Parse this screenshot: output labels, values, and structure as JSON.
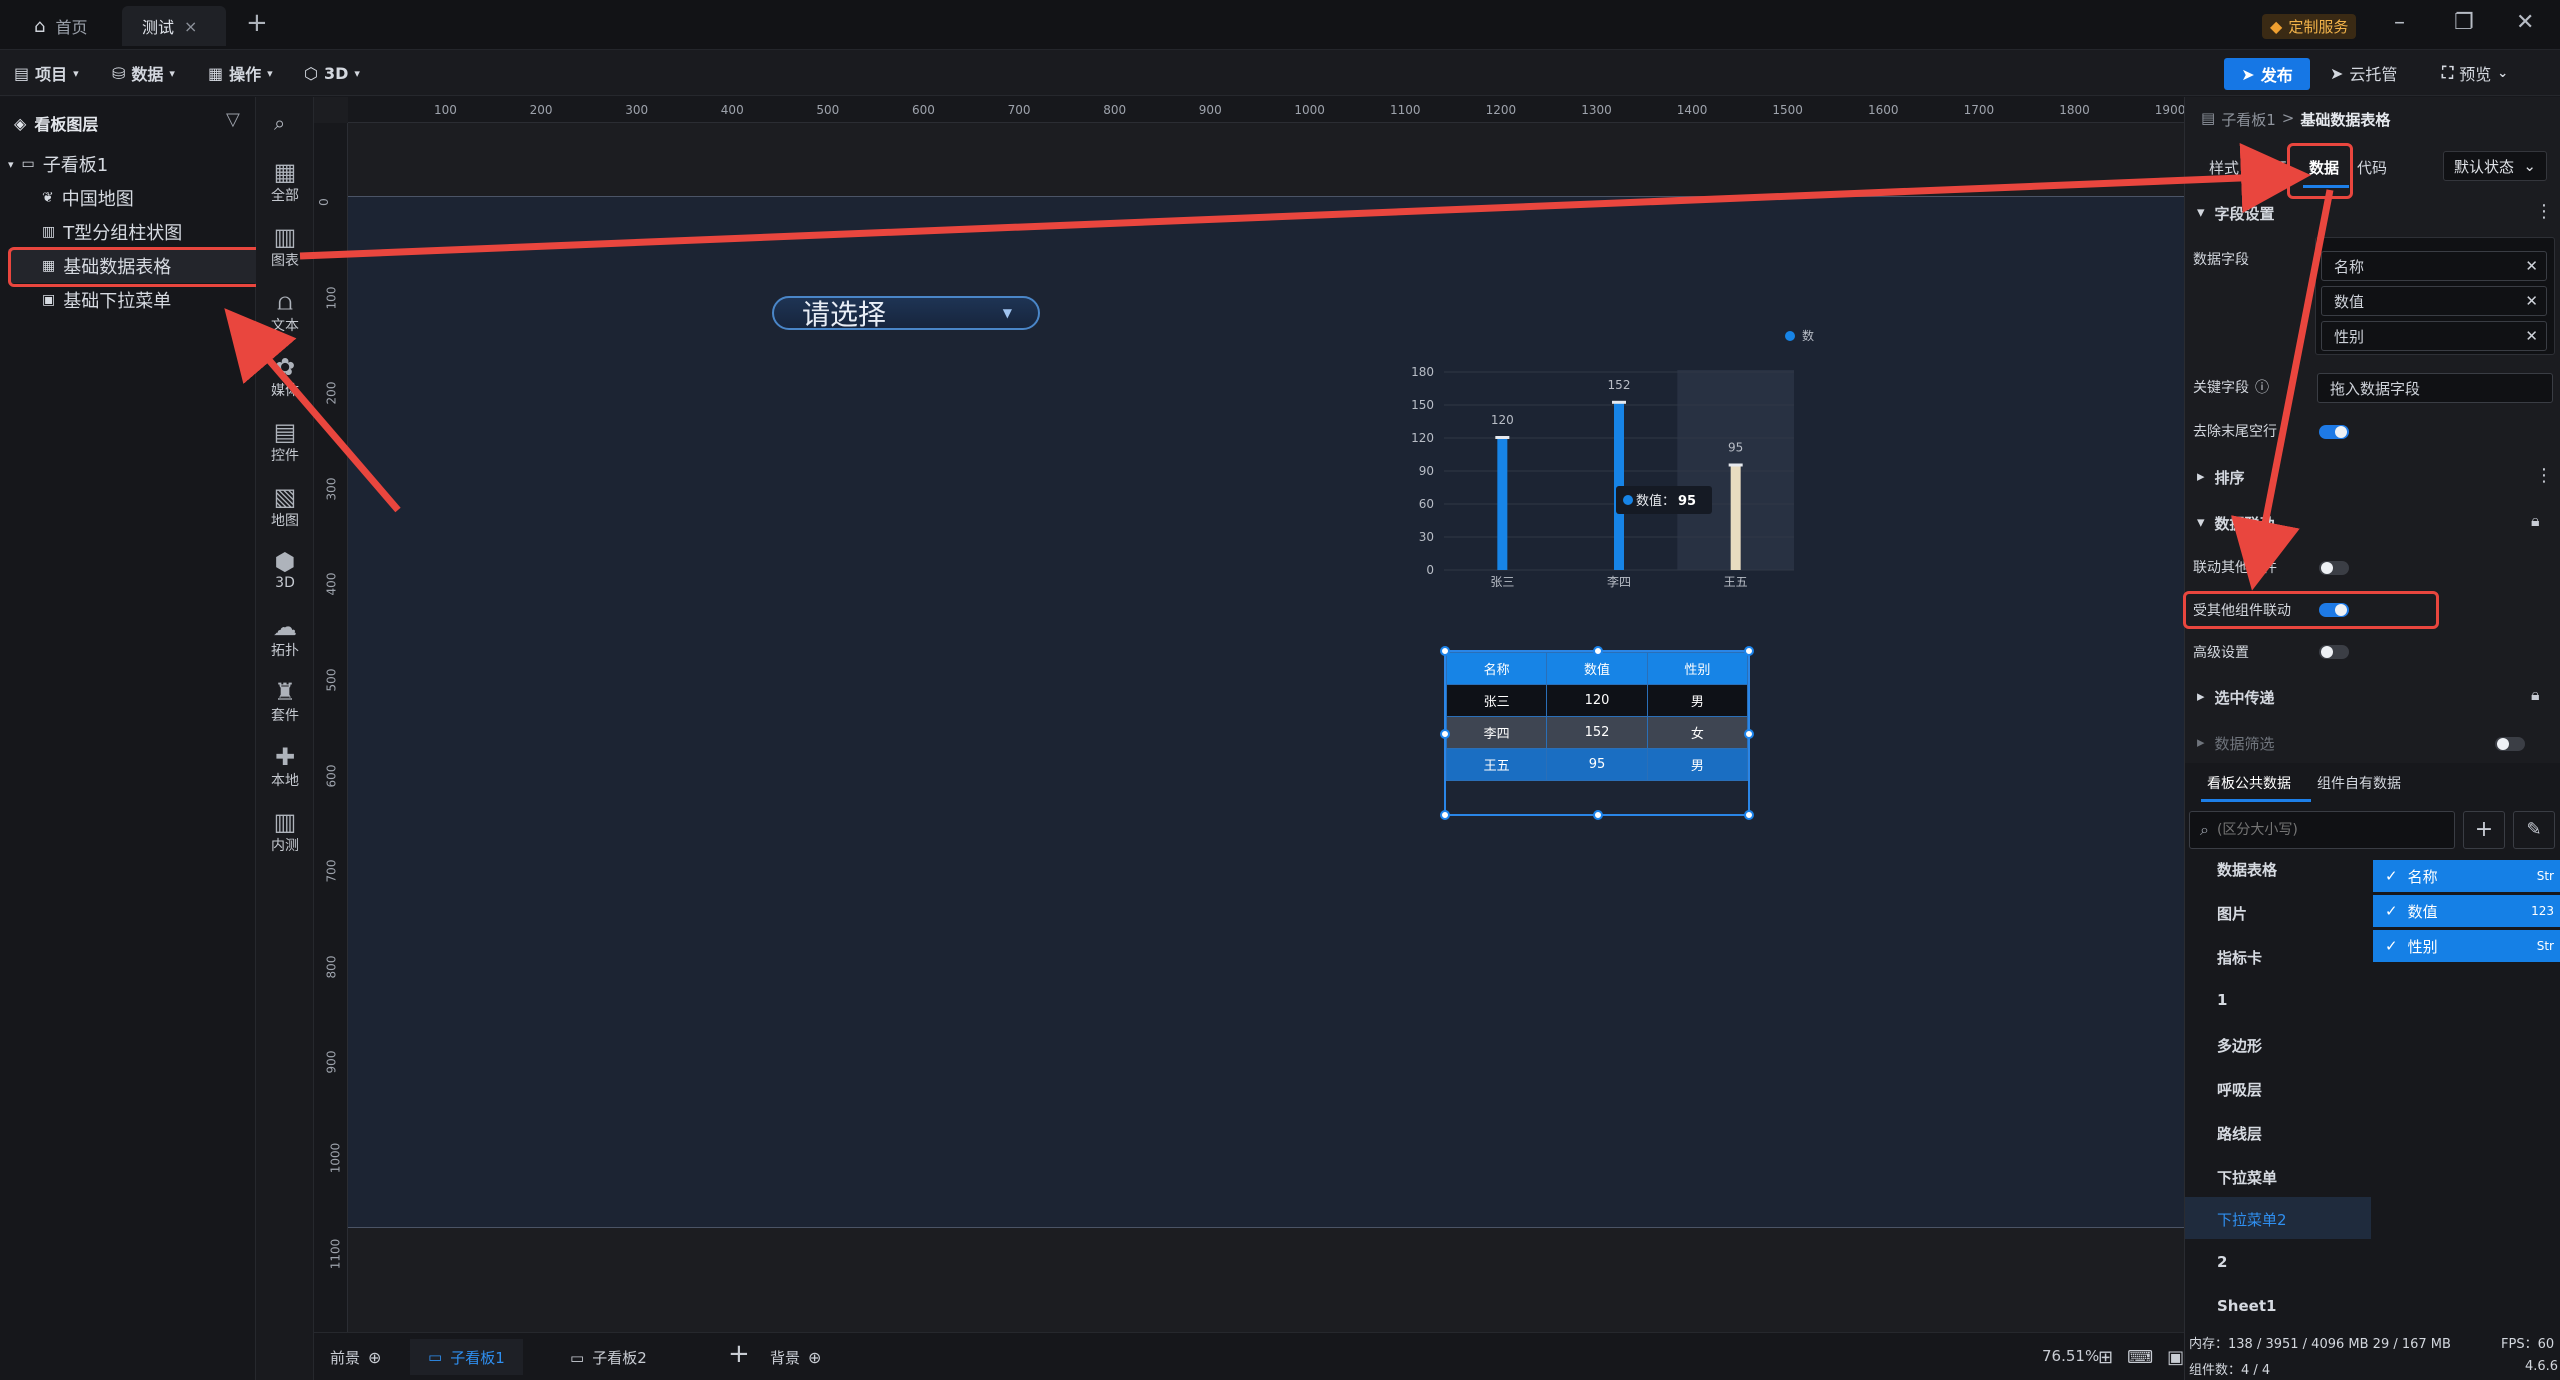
{
  "titlebar": {
    "tabs": [
      {
        "label": "首页",
        "icon": "home-icon"
      },
      {
        "label": "测试",
        "close": "×"
      }
    ],
    "add_tab": "+",
    "service_badge": "定制服务",
    "win_min": "–",
    "win_restore": "❐",
    "win_close": "✕"
  },
  "toolbar": {
    "menus": [
      "项目",
      "数据",
      "操作",
      "3D"
    ],
    "publish": "发布",
    "cloud": "云托管",
    "preview": "预览"
  },
  "left_panel": {
    "title": "看板图层",
    "tree": [
      {
        "label": "子看板1",
        "icon": "board-icon",
        "level": 0
      },
      {
        "label": "中国地图",
        "icon": "map-icon",
        "level": 1
      },
      {
        "label": "T型分组柱状图",
        "icon": "bar-chart-icon",
        "level": 1
      },
      {
        "label": "基础数据表格",
        "icon": "table-icon",
        "level": 1
      },
      {
        "label": "基础下拉菜单",
        "icon": "dropdown-icon",
        "level": 1
      }
    ]
  },
  "icon_bar": [
    "全部",
    "图表",
    "文本",
    "媒体",
    "控件",
    "地图",
    "3D",
    "拓扑",
    "套件",
    "本地",
    "内测"
  ],
  "ruler": {
    "h_labels": [
      "100",
      "200",
      "300",
      "400",
      "500",
      "600",
      "700",
      "800",
      "900",
      "1000",
      "1100",
      "1200",
      "1300",
      "1400",
      "1500",
      "1600",
      "1700",
      "1800",
      "1900"
    ],
    "v_labels": [
      "0",
      "100",
      "200",
      "300",
      "400",
      "500",
      "600",
      "700",
      "800",
      "900",
      "1000",
      "1100"
    ]
  },
  "canvas": {
    "dropdown_placeholder": "请选择",
    "chart_legend": "数值",
    "chart_tooltip_label": "数值：",
    "chart_tooltip_value": "95",
    "table": {
      "headers": [
        "名称",
        "数值",
        "性别"
      ],
      "rows": [
        [
          "张三",
          "120",
          "男"
        ],
        [
          "李四",
          "152",
          "女"
        ],
        [
          "王五",
          "95",
          "男"
        ]
      ]
    }
  },
  "chart_data": {
    "type": "bar",
    "categories": [
      "张三",
      "李四",
      "王五"
    ],
    "series": [
      {
        "name": "数值",
        "values": [
          120,
          152,
          95
        ]
      }
    ],
    "yticks": [
      0,
      30,
      60,
      90,
      120,
      150,
      180
    ],
    "ylim": [
      0,
      180
    ],
    "legend": "top-right",
    "colors": [
      "#1784e6",
      "#1784e6",
      "#e8dcc0"
    ]
  },
  "bottom_bar": {
    "foreground": "前景",
    "board1": "子看板1",
    "board2": "子看板2",
    "add": "+",
    "background": "背景",
    "zoom": "76.51%"
  },
  "status": {
    "memory": "内存：138 / 3951 / 4096 MB  29 / 167 MB",
    "components": "组件数：4 / 4",
    "fps": "FPS：60",
    "version": "4.6.6"
  },
  "right_panel": {
    "breadcrumb_root": "子看板1",
    "breadcrumb_sep": ">",
    "breadcrumb_current": "基础数据表格",
    "tabs": [
      "样式",
      "交互",
      "数据",
      "代码"
    ],
    "state_select": "默认状态",
    "field_section": "字段设置",
    "data_field_label": "数据字段",
    "data_fields": [
      "名称",
      "数值",
      "性别"
    ],
    "key_field_label": "关键字段",
    "key_field_placeholder": "拖入数据字段",
    "trim_empty_label": "去除末尾空行",
    "sort_section": "排序",
    "linkage_section": "数据联动",
    "link_others_label": "联动其他组件",
    "linked_by_others_label": "受其他组件联动",
    "advanced_label": "高级设置",
    "selection_section": "选中传递",
    "filter_section": "数据筛选",
    "public_data_tab": "看板公共数据",
    "own_data_tab": "组件自有数据",
    "search_placeholder": "(区分大小写)",
    "data_list": [
      "数据表格",
      "图片",
      "指标卡",
      "1",
      "多边形",
      "呼吸层",
      "路线层",
      "下拉菜单",
      "下拉菜单2",
      "2",
      "Sheet1"
    ],
    "checked_fields": [
      {
        "label": "名称",
        "type": "Str"
      },
      {
        "label": "数值",
        "type": "123"
      },
      {
        "label": "性别",
        "type": "Str"
      }
    ]
  }
}
